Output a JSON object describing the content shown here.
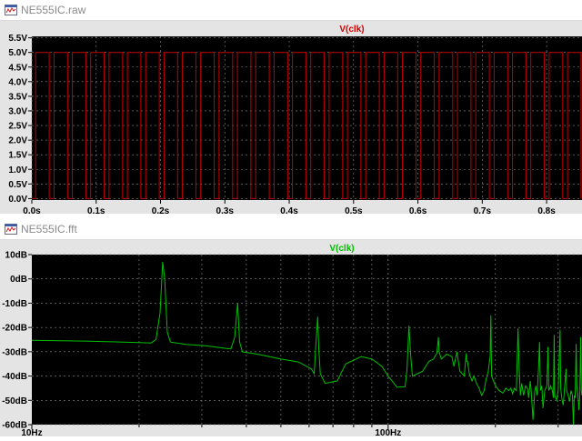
{
  "windows": {
    "top": {
      "title": "NE555IC.raw",
      "trace_label": "V(clk)",
      "trace_color": "#c00000",
      "y_ticks": [
        "5.5V",
        "5.0V",
        "4.5V",
        "4.0V",
        "3.5V",
        "3.0V",
        "2.5V",
        "2.0V",
        "1.5V",
        "1.0V",
        "0.5V",
        "0.0V"
      ],
      "x_ticks": [
        "0.0s",
        "0.1s",
        "0.2s",
        "0.3s",
        "0.4s",
        "0.5s",
        "0.6s",
        "0.7s",
        "0.8s"
      ]
    },
    "bottom": {
      "title": "NE555IC.fft",
      "trace_label": "V(clk)",
      "trace_color": "#00c000",
      "y_ticks": [
        "10dB",
        "0dB",
        "-10dB",
        "-20dB",
        "-30dB",
        "-40dB",
        "-50dB",
        "-60dB"
      ],
      "x_ticks": [
        "10Hz",
        "100Hz"
      ]
    }
  },
  "chart_data": [
    {
      "type": "line",
      "title": "V(clk)",
      "xlabel": "",
      "ylabel": "",
      "x_unit": "s",
      "y_unit": "V",
      "xlim": [
        0.0,
        0.855
      ],
      "ylim": [
        -0.05,
        5.55
      ],
      "grid": true,
      "series": [
        {
          "name": "V(clk)",
          "kind": "square_wave",
          "high": 5.0,
          "low": 0.0,
          "period": 0.0285,
          "high_time": 0.021,
          "first_rise": 0.006
        }
      ]
    },
    {
      "type": "line",
      "title": "V(clk)",
      "xlabel": "",
      "ylabel": "",
      "x_unit": "Hz",
      "y_unit": "dB",
      "x_scale": "log",
      "xlim": [
        10,
        350
      ],
      "ylim": [
        -60,
        10
      ],
      "grid": true,
      "series": [
        {
          "name": "V(clk)",
          "points": [
            [
              10,
              -25.3
            ],
            [
              14,
              -25.6
            ],
            [
              18,
              -26.0
            ],
            [
              20,
              -26.2
            ],
            [
              21.6,
              -26.4
            ],
            [
              22.3,
              -25.0
            ],
            [
              22.9,
              -14.0
            ],
            [
              23.3,
              7.0
            ],
            [
              23.6,
              0.0
            ],
            [
              24.0,
              -22.0
            ],
            [
              24.5,
              -26.0
            ],
            [
              27,
              -27.0
            ],
            [
              31,
              -27.6
            ],
            [
              35,
              -28.6
            ],
            [
              36.2,
              -28.8
            ],
            [
              37.1,
              -24.0
            ],
            [
              37.8,
              -10.0
            ],
            [
              38.3,
              -26.0
            ],
            [
              39.0,
              -30.0
            ],
            [
              43,
              -31.0
            ],
            [
              50,
              -33.0
            ],
            [
              56,
              -34.2
            ],
            [
              60.8,
              -37.0
            ],
            [
              62.0,
              -39.0
            ],
            [
              62.8,
              -25.0
            ],
            [
              63.4,
              -15.6
            ],
            [
              63.9,
              -29.0
            ],
            [
              64.5,
              -39.0
            ],
            [
              66.5,
              -43.0
            ],
            [
              72,
              -42.0
            ],
            [
              76,
              -35.0
            ],
            [
              84,
              -32.0
            ],
            [
              90,
              -33.0
            ],
            [
              96,
              -36.0
            ],
            [
              100,
              -40.0
            ],
            [
              106,
              -44.6
            ],
            [
              111.6,
              -44.4
            ],
            [
              113.0,
              -37.0
            ],
            [
              114.4,
              -19.2
            ],
            [
              115.6,
              -31.0
            ],
            [
              117,
              -40.0
            ],
            [
              125,
              -38.0
            ],
            [
              130,
              -34.0
            ],
            [
              134,
              -33.0
            ],
            [
              137,
              -30.6
            ],
            [
              138.4,
              -24.0
            ],
            [
              139.0,
              -30.0
            ],
            [
              141,
              -33.0
            ],
            [
              146,
              -31.0
            ],
            [
              151,
              -32.0
            ],
            [
              153,
              -36.0
            ],
            [
              156,
              -30.0
            ],
            [
              159,
              -38.0
            ],
            [
              163.5,
              -40.0
            ],
            [
              165.6,
              -30.6
            ],
            [
              166.2,
              -34.0
            ],
            [
              167,
              -34.0
            ],
            [
              169,
              -39.0
            ],
            [
              172,
              -42.0
            ],
            [
              174,
              -40.0
            ],
            [
              177,
              -43.0
            ],
            [
              180,
              -45.0
            ],
            [
              183,
              -48.0
            ],
            [
              186,
              -46.0
            ],
            [
              188,
              -42.0
            ],
            [
              191,
              -38.0
            ],
            [
              193.3,
              -32.0
            ],
            [
              194.2,
              -15.0
            ],
            [
              195.2,
              -40.0
            ],
            [
              200,
              -44.0
            ],
            [
              205,
              -46.0
            ],
            [
              210,
              -47.0
            ],
            [
              214,
              -45.0
            ],
            [
              218,
              -46.0
            ],
            [
              221,
              -45.0
            ],
            [
              223.5,
              -47.4
            ],
            [
              226,
              -45.0
            ],
            [
              229,
              -46.0
            ],
            [
              231.5,
              -20.4
            ],
            [
              233,
              -36.0
            ],
            [
              235,
              -48.0
            ],
            [
              237,
              -43.0
            ],
            [
              240,
              -48.0
            ],
            [
              243,
              -44.0
            ],
            [
              246,
              -45.0
            ],
            [
              248,
              -49.0
            ],
            [
              250.5,
              -42.0
            ],
            [
              252,
              -46.0
            ],
            [
              255,
              -58.0
            ],
            [
              258,
              -46.0
            ],
            [
              260,
              -44.0
            ],
            [
              262,
              -48.0
            ],
            [
              264.4,
              -36.0
            ],
            [
              266,
              -26.0
            ],
            [
              267.5,
              -46.0
            ],
            [
              270,
              -44.0
            ],
            [
              272,
              -53.2
            ],
            [
              275,
              -46.0
            ],
            [
              279,
              -44.0
            ],
            [
              281,
              -28.0
            ],
            [
              282.5,
              -46.0
            ],
            [
              286,
              -44.0
            ],
            [
              289,
              -46.0
            ],
            [
              291,
              -49.0
            ],
            [
              292.4,
              -23.0
            ],
            [
              293.5,
              -48.0
            ],
            [
              297,
              -50.0
            ],
            [
              300,
              -46.0
            ],
            [
              303.8,
              -21.0
            ],
            [
              305,
              -45.0
            ],
            [
              307,
              -49.0
            ],
            [
              310,
              -52.0
            ],
            [
              313,
              -44.0
            ],
            [
              315.8,
              -37.0
            ],
            [
              317,
              -46.0
            ],
            [
              320,
              -48.0
            ],
            [
              323,
              -50.5
            ],
            [
              326,
              -46.0
            ],
            [
              329,
              -48.0
            ],
            [
              331,
              -60.0
            ],
            [
              333,
              -48.0
            ],
            [
              335,
              -49.0
            ],
            [
              337,
              -26.8
            ],
            [
              338.5,
              -44.0
            ],
            [
              341,
              -48.0
            ],
            [
              343,
              -54.0
            ],
            [
              345,
              -48.0
            ],
            [
              347,
              -24.0
            ],
            [
              348.5,
              -46.0
            ],
            [
              350,
              -48.0
            ]
          ]
        }
      ]
    }
  ]
}
